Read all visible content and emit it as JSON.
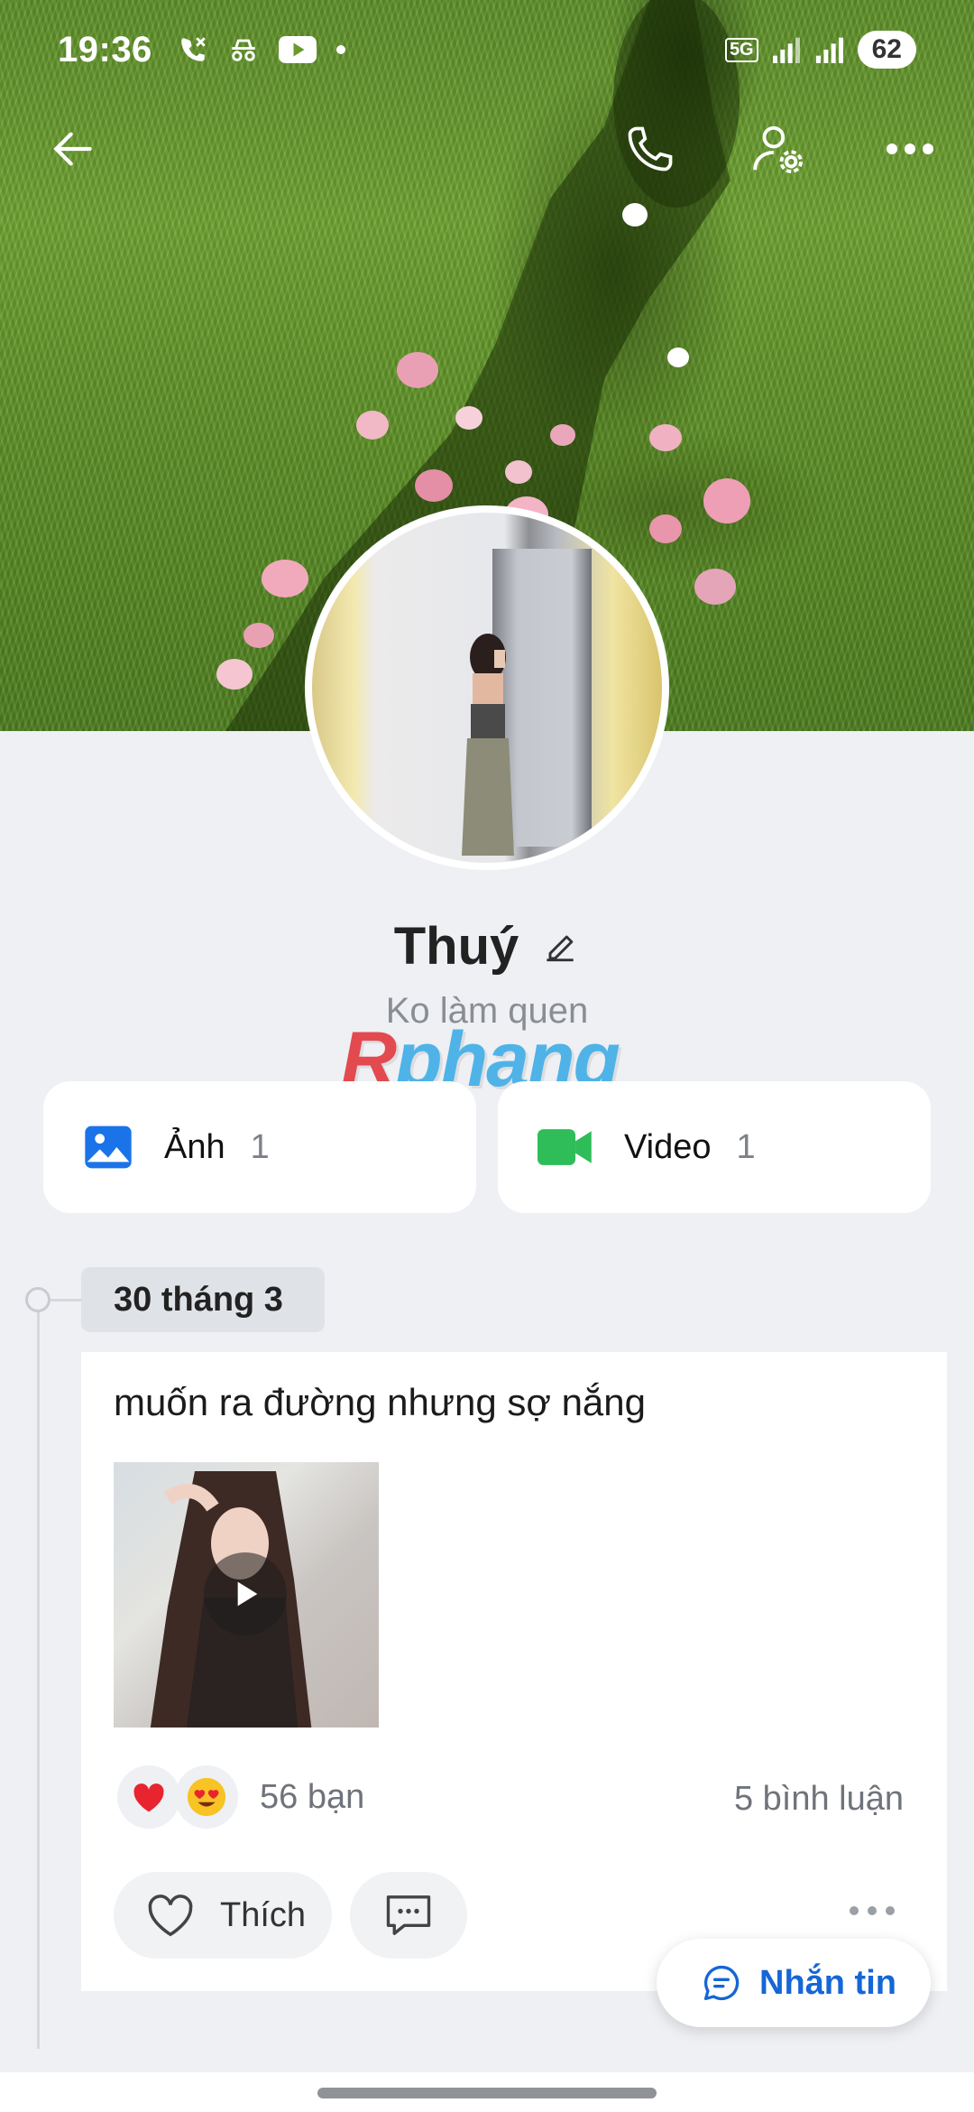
{
  "status_bar": {
    "time": "19:36",
    "network": "5G",
    "battery": "62"
  },
  "profile": {
    "name": "Thuý",
    "bio": "Ko làm quen",
    "watermark": "Rphang"
  },
  "media": [
    {
      "label": "Ảnh",
      "count": "1",
      "icon": "photo-icon",
      "color": "#1a73e8"
    },
    {
      "label": "Video",
      "count": "1",
      "icon": "video-camera-icon",
      "color": "#2ebd59"
    }
  ],
  "timeline": {
    "date": "30 tháng 3"
  },
  "post": {
    "text": "muốn ra đường nhưng sợ nắng",
    "reaction_count": "56 bạn",
    "comments_count": "5 bình luận",
    "like_label": "Thích"
  },
  "fab": {
    "label": "Nhắn tin"
  },
  "colors": {
    "accent": "#1566d6",
    "background": "#eef0f4"
  }
}
